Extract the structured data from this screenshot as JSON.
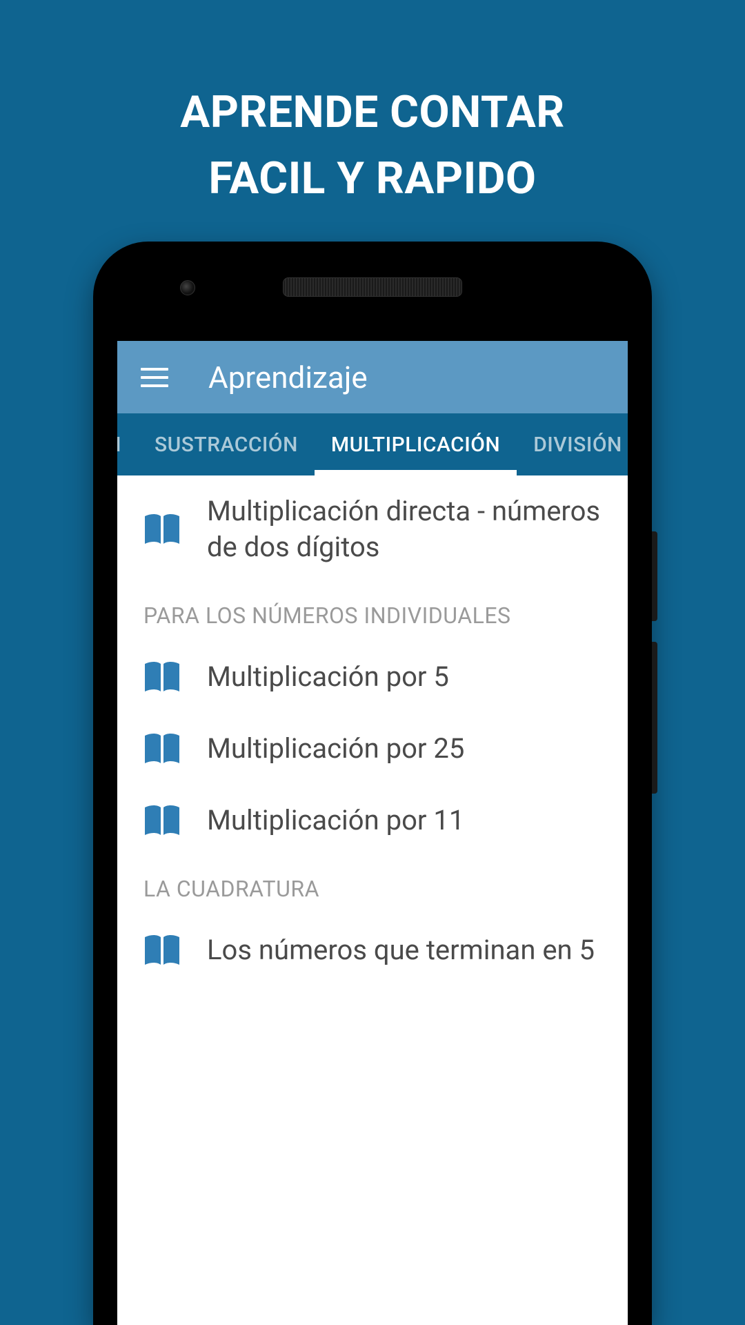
{
  "hero": {
    "line1": "APRENDE CONTAR",
    "line2": "FACIL Y RAPIDO"
  },
  "appbar": {
    "title": "Aprendizaje"
  },
  "tabs": [
    {
      "label": "IÓN",
      "active": false
    },
    {
      "label": "SUSTRACCIÓN",
      "active": false
    },
    {
      "label": "MULTIPLICACIÓN",
      "active": true
    },
    {
      "label": "DIVISIÓN",
      "active": false
    }
  ],
  "content": {
    "item_top": "Multiplicación directa - números de dos dígitos",
    "section1_header": "PARA LOS NÚMEROS INDIVIDUALES",
    "section1_items": [
      "Multiplicación por 5",
      "Multiplicación por 25",
      "Multiplicación por 11"
    ],
    "section2_header": "LA CUADRATURA",
    "section2_items": [
      "Los números que terminan en 5"
    ]
  },
  "colors": {
    "background": "#0f6490",
    "appbar": "#5c99c3",
    "icon": "#2f7eb5"
  }
}
